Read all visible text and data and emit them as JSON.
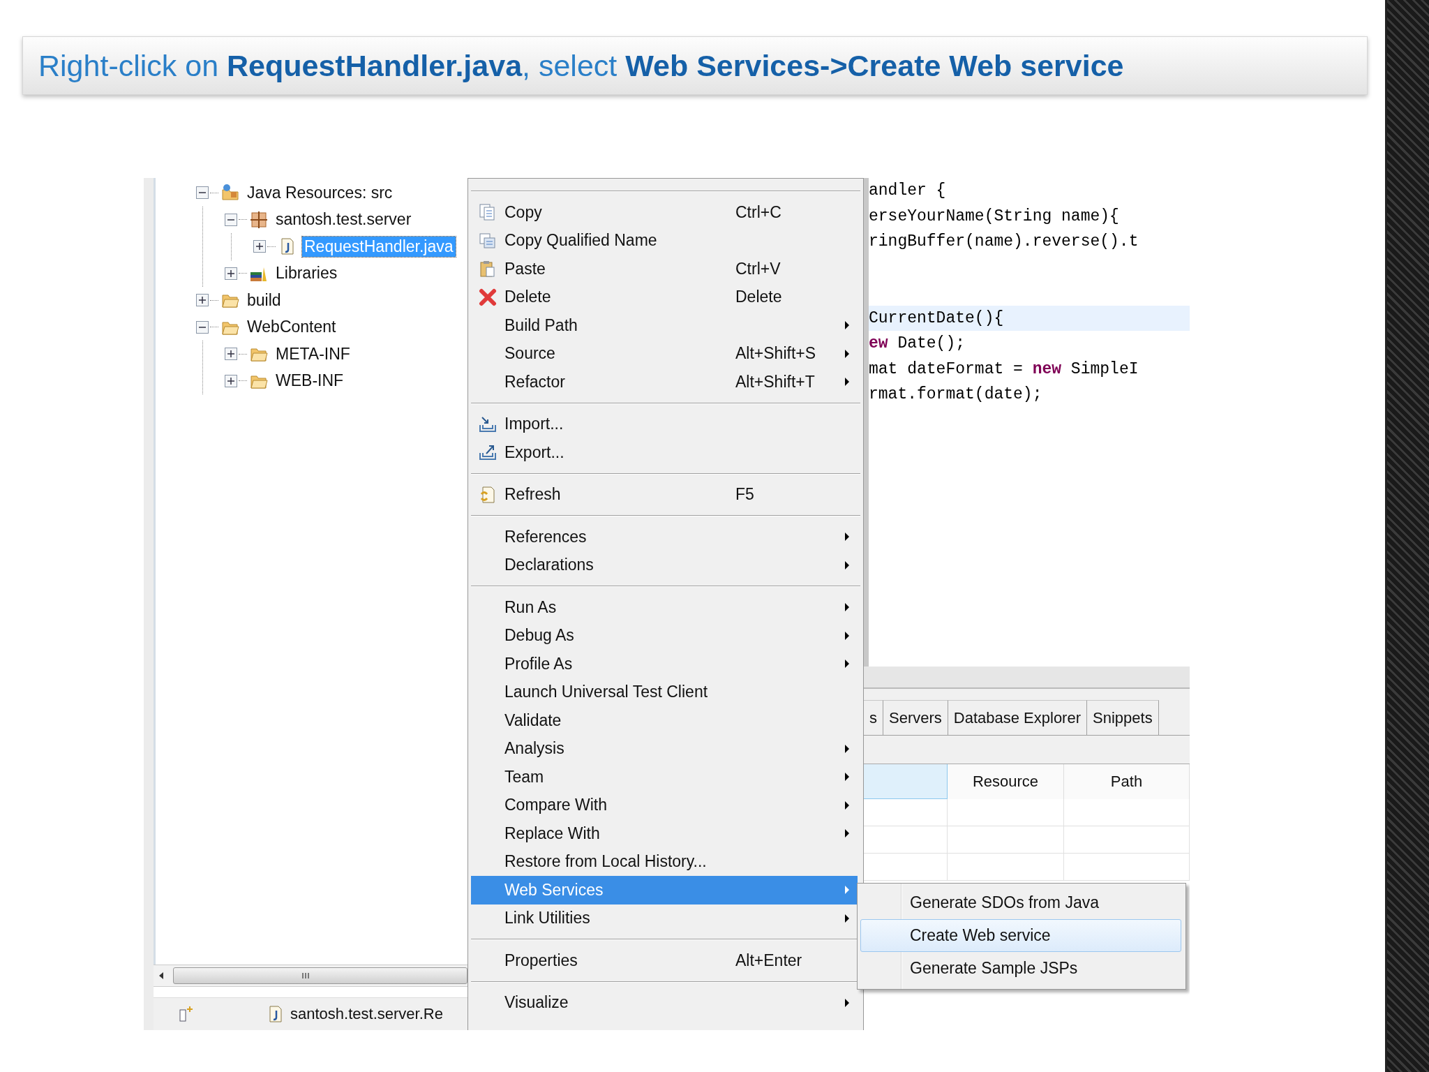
{
  "slide_title": "Right-click on **RequestHandler.java**, select **Web Services->Create Web service**",
  "project_tree": {
    "nodes": [
      {
        "label": "Java Resources: src",
        "kind": "source-folder",
        "expanded": true,
        "selected": false,
        "children": [
          {
            "label": "santosh.test.server",
            "kind": "package",
            "expanded": true,
            "selected": false,
            "children": [
              {
                "label": "RequestHandler.java",
                "kind": "java-file",
                "expanded": false,
                "selected": true
              }
            ]
          },
          {
            "label": "Libraries",
            "kind": "library",
            "expanded": false,
            "selected": false
          }
        ]
      },
      {
        "label": "build",
        "kind": "folder",
        "expanded": false,
        "selected": false
      },
      {
        "label": "WebContent",
        "kind": "folder",
        "expanded": true,
        "selected": false,
        "children": [
          {
            "label": "META-INF",
            "kind": "folder",
            "expanded": false,
            "selected": false
          },
          {
            "label": "WEB-INF",
            "kind": "folder",
            "expanded": false,
            "selected": false
          }
        ]
      }
    ]
  },
  "status_bar": {
    "file": "santosh.test.server.Re"
  },
  "context_menu": {
    "items": [
      {
        "kind": "separator"
      },
      {
        "kind": "copy",
        "label": "Copy",
        "shortcut": "Ctrl+C",
        "submenu": false,
        "selected": false
      },
      {
        "kind": "copy-name",
        "label": "Copy Qualified Name",
        "submenu": false,
        "selected": false
      },
      {
        "kind": "paste",
        "label": "Paste",
        "shortcut": "Ctrl+V",
        "submenu": false,
        "selected": false
      },
      {
        "kind": "delete",
        "label": "Delete",
        "shortcut": "Delete",
        "submenu": false,
        "selected": false
      },
      {
        "kind": "plain",
        "label": "Build Path",
        "submenu": true,
        "selected": false
      },
      {
        "kind": "plain",
        "label": "Source",
        "shortcut": "Alt+Shift+S",
        "submenu": true,
        "selected": false
      },
      {
        "kind": "plain",
        "label": "Refactor",
        "shortcut": "Alt+Shift+T",
        "submenu": true,
        "selected": false
      },
      {
        "kind": "separator"
      },
      {
        "kind": "import",
        "label": "Import...",
        "submenu": false,
        "selected": false
      },
      {
        "kind": "export",
        "label": "Export...",
        "submenu": false,
        "selected": false
      },
      {
        "kind": "separator"
      },
      {
        "kind": "refresh",
        "label": "Refresh",
        "shortcut": "F5",
        "submenu": false,
        "selected": false
      },
      {
        "kind": "separator"
      },
      {
        "kind": "plain",
        "label": "References",
        "submenu": true,
        "selected": false
      },
      {
        "kind": "plain",
        "label": "Declarations",
        "submenu": true,
        "selected": false
      },
      {
        "kind": "separator"
      },
      {
        "kind": "plain",
        "label": "Run As",
        "submenu": true,
        "selected": false
      },
      {
        "kind": "plain",
        "label": "Debug As",
        "submenu": true,
        "selected": false
      },
      {
        "kind": "plain",
        "label": "Profile As",
        "submenu": true,
        "selected": false
      },
      {
        "kind": "plain",
        "label": "Launch Universal Test Client",
        "submenu": false,
        "selected": false
      },
      {
        "kind": "plain",
        "label": "Validate",
        "submenu": false,
        "selected": false
      },
      {
        "kind": "plain",
        "label": "Analysis",
        "submenu": true,
        "selected": false
      },
      {
        "kind": "plain",
        "label": "Team",
        "submenu": true,
        "selected": false
      },
      {
        "kind": "plain",
        "label": "Compare With",
        "submenu": true,
        "selected": false
      },
      {
        "kind": "plain",
        "label": "Replace With",
        "submenu": true,
        "selected": false
      },
      {
        "kind": "plain",
        "label": "Restore from Local History...",
        "submenu": false,
        "selected": false
      },
      {
        "kind": "plain",
        "label": "Web Services",
        "submenu": true,
        "selected": true
      },
      {
        "kind": "plain",
        "label": "Link Utilities",
        "submenu": true,
        "selected": false
      },
      {
        "kind": "separator"
      },
      {
        "kind": "plain",
        "label": "Properties",
        "shortcut": "Alt+Enter",
        "submenu": false,
        "selected": false
      },
      {
        "kind": "separator"
      },
      {
        "kind": "plain",
        "label": "Visualize",
        "submenu": true,
        "selected": false
      }
    ]
  },
  "submenu": {
    "items": [
      {
        "label": "Generate SDOs from Java",
        "selected": false
      },
      {
        "label": "Create Web service",
        "selected": true
      },
      {
        "label": "Generate Sample JSPs",
        "selected": false
      }
    ]
  },
  "editor": {
    "lines": [
      {
        "current": false,
        "tokens": [
          {
            "kind": "plain",
            "text": "andler {"
          }
        ]
      },
      {
        "current": false,
        "tokens": [
          {
            "kind": "plain",
            "text": "erseYourName(String name){"
          }
        ]
      },
      {
        "current": false,
        "tokens": [
          {
            "kind": "plain",
            "text": "ringBuffer(name).reverse().t"
          }
        ]
      },
      {
        "current": false
      },
      {
        "current": false
      },
      {
        "current": true,
        "tokens": [
          {
            "kind": "plain",
            "text": "CurrentDate(){"
          }
        ]
      },
      {
        "current": false,
        "tokens": [
          {
            "kind": "keyword",
            "text": "ew"
          },
          {
            "kind": "plain",
            "text": " Date();"
          }
        ]
      },
      {
        "current": false,
        "tokens": [
          {
            "kind": "plain",
            "text": "mat dateFormat = "
          },
          {
            "kind": "keyword",
            "text": "new"
          },
          {
            "kind": "plain",
            "text": " SimpleI"
          }
        ]
      },
      {
        "current": false,
        "tokens": [
          {
            "kind": "plain",
            "text": "rmat.format(date);"
          }
        ]
      }
    ]
  },
  "bottom_panel": {
    "tabs": [
      {
        "label": "s",
        "selected": false
      },
      {
        "label": "Servers",
        "selected": false
      },
      {
        "label": "Database Explorer",
        "selected": false
      },
      {
        "label": "Snippets",
        "selected": false
      }
    ],
    "columns": [
      {
        "selected": true
      },
      {
        "label": "Resource",
        "selected": false
      },
      {
        "label": "Path",
        "selected": false
      }
    ]
  }
}
